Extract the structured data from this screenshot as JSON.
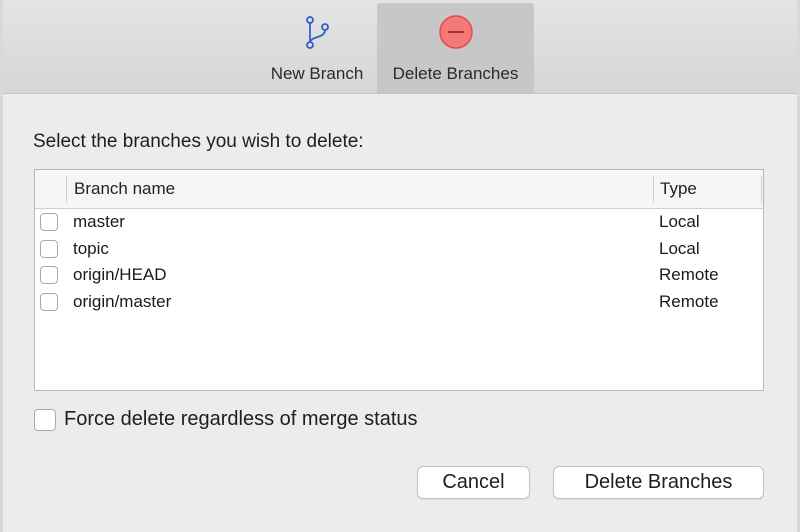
{
  "toolbar": {
    "new_branch_label": "New Branch",
    "delete_branches_label": "Delete Branches",
    "new_branch_icon": "branch-icon",
    "delete_branches_icon": "minus-circle-icon",
    "accent_color": "#2f5fd0",
    "delete_icon_color": "#f47a7a"
  },
  "dialog": {
    "prompt": "Select the branches you wish to delete:",
    "columns": {
      "name": "Branch name",
      "type": "Type"
    },
    "branches": [
      {
        "name": "master",
        "type": "Local",
        "checked": false
      },
      {
        "name": "topic",
        "type": "Local",
        "checked": false
      },
      {
        "name": "origin/HEAD",
        "type": "Remote",
        "checked": false
      },
      {
        "name": "origin/master",
        "type": "Remote",
        "checked": false
      }
    ],
    "force_label": "Force delete regardless of merge status",
    "force_checked": false,
    "cancel_label": "Cancel",
    "delete_label": "Delete Branches"
  }
}
